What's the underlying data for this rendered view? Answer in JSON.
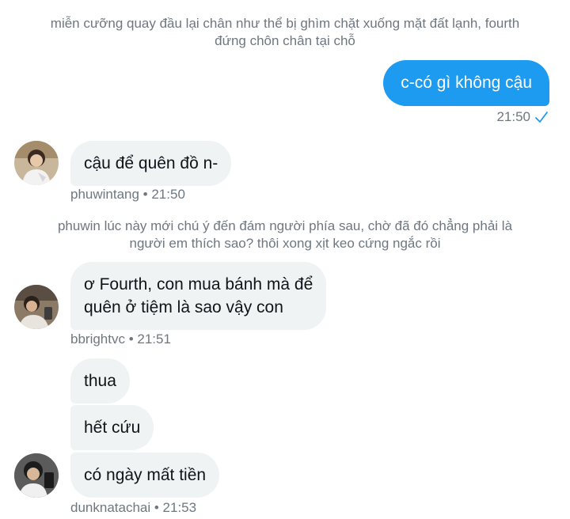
{
  "narration_1": [
    "miễn cưỡng quay đầu lại chân như thể bị ghìm chặt xuống mặt đất lạnh, fourth",
    "đứng chôn chân tại chỗ"
  ],
  "sent": {
    "text": "c-có gì không cậu",
    "time": "21:50"
  },
  "msg1": {
    "text": "cậu để quên đồ n-",
    "meta": "phuwintang • 21:50"
  },
  "narration_2": [
    "phuwin lúc này mới chú ý đến đám người phía sau, chờ đã đó chẳng phải là",
    "người em thích sao? thôi xong xịt keo cứng ngắc rồi"
  ],
  "msg2": {
    "lines": [
      "ơ Fourth, con mua bánh mà để",
      "quên ở tiệm là sao vậy con"
    ],
    "meta": "bbrightvc • 21:51"
  },
  "msg3": {
    "texts": [
      "thua",
      "hết cứu",
      "có ngày mất tiền"
    ],
    "meta": "dunknatachai • 21:53"
  },
  "colors": {
    "accent": "#1d9bf0",
    "bubble": "#eff3f4",
    "meta": "#6e7780"
  },
  "icons": [
    "sent-check-icon",
    "avatar"
  ]
}
